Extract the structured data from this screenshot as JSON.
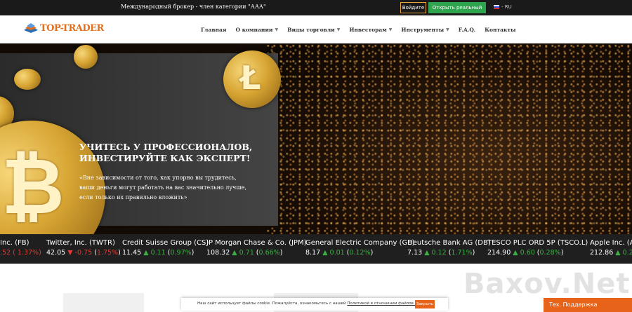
{
  "topbar": {
    "tagline": "Международный брокер - член категории \"ААА\"",
    "login_label": "Войдите",
    "open_account_label": "Открыть реальный счет",
    "language": "- RU"
  },
  "header": {
    "logo_text": "TOP-TRADER",
    "nav": [
      {
        "label": "Главная"
      },
      {
        "label": "О компании"
      },
      {
        "label": "Виды торговли"
      },
      {
        "label": "Инвесторам"
      },
      {
        "label": "Инструменты"
      },
      {
        "label": "F.A.Q."
      },
      {
        "label": "Контакты"
      }
    ]
  },
  "hero": {
    "title_line1": "УЧИТЕСЬ У ПРОФЕССИОНАЛОВ,",
    "title_line2": "ИНВЕСТИРУЙТЕ КАК ЭКСПЕРТ!",
    "quote_line1": "«Вне зависимости от того, как упорно вы трудитесь,",
    "quote_line2": "ваши деньги могут работать на вас значительно лучше,",
    "quote_line3": "если только их правильно вложить»",
    "litecoin_symbol": "Ł",
    "bitcoin_symbol": "₿"
  },
  "ticker": [
    {
      "name": "Inc. (FB)",
      "price": ".52",
      "change": "1.37%",
      "delta": "",
      "direction": "down",
      "arrow": ""
    },
    {
      "name": "Twitter, Inc. (TWTR)",
      "price": "42.05",
      "delta": "-0.75",
      "change": "1.75%",
      "direction": "down",
      "arrow": "▼"
    },
    {
      "name": "Credit Suisse Group (CS)",
      "price": "11.45",
      "delta": "0.11",
      "change": "0.97%",
      "direction": "up",
      "arrow": "▲"
    },
    {
      "name": "JP Morgan Chase & Co. (JPM)",
      "price": "108.32",
      "delta": "0.71",
      "change": "0.66%",
      "direction": "up",
      "arrow": "▲"
    },
    {
      "name": "General Electric Company (GE)",
      "price": "8.17",
      "delta": "0.01",
      "change": "0.12%",
      "direction": "up",
      "arrow": "▲"
    },
    {
      "name": "Deutsche Bank AG (DB)",
      "price": "7.13",
      "delta": "0.12",
      "change": "1.71%",
      "direction": "up",
      "arrow": "▲"
    },
    {
      "name": "TESCO PLC ORD 5P (TSCO.L)",
      "price": "214.90",
      "delta": "0.60",
      "change": "0.28%",
      "direction": "up",
      "arrow": "▲"
    },
    {
      "name": "Apple Inc. (AA",
      "price": "212.86",
      "delta": "0.2",
      "change": "",
      "direction": "up",
      "arrow": "▲"
    }
  ],
  "cookie": {
    "text": "Наш сайт использует файлы cookie. Пожалуйста, ознакомьтесь с нашей",
    "link": "Политикой в отношении файлов cookie.",
    "button": "Закрыть"
  },
  "support_label": "Тех. Поддержка",
  "watermark": "Baxov.Net",
  "colors": {
    "accent": "#e8631a",
    "up": "#3cb043",
    "down": "#e53935",
    "cta_green": "#2ea44f"
  }
}
